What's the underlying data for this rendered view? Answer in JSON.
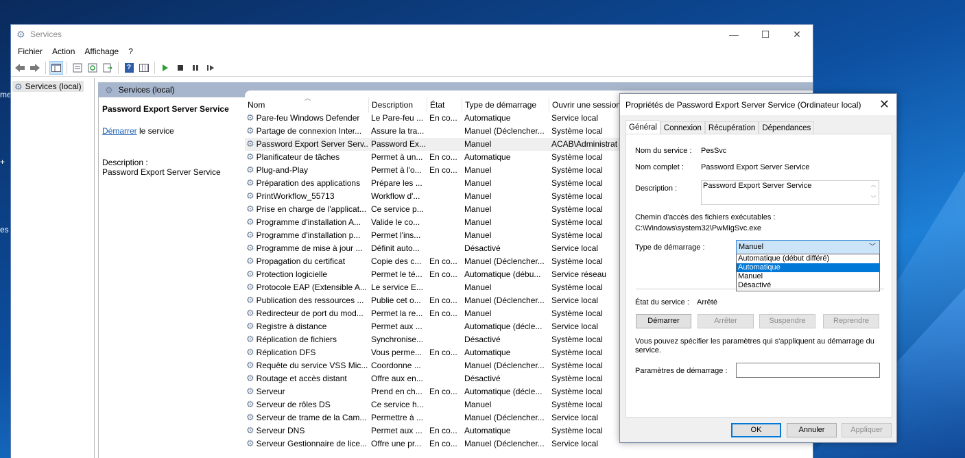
{
  "desktop": {
    "fragments": [
      "me",
      "+",
      "es"
    ]
  },
  "window": {
    "title": "Services",
    "controls": {
      "minimize": "—",
      "maximize": "☐",
      "close": "✕"
    }
  },
  "menu": [
    "Fichier",
    "Action",
    "Affichage",
    "?"
  ],
  "tree": {
    "root": "Services (local)"
  },
  "panel": {
    "header": "Services (local)"
  },
  "extended": {
    "service_name": "Password Export Server Service",
    "start_link": "Démarrer",
    "start_suffix": " le service",
    "description_label": "Description :",
    "description": "Password Export Server Service"
  },
  "columns": [
    "Nom",
    "Description",
    "État",
    "Type de démarrage",
    "Ouvrir une session"
  ],
  "rows": [
    {
      "name": "Pare-feu Windows Defender",
      "desc": "Le Pare-feu ...",
      "state": "En co...",
      "type": "Automatique",
      "logon": "Service local"
    },
    {
      "name": "Partage de connexion Inter...",
      "desc": "Assure la tra...",
      "state": "",
      "type": "Manuel (Déclencher...",
      "logon": "Système local"
    },
    {
      "name": "Password Export Server Serv...",
      "desc": "Password Ex...",
      "state": "",
      "type": "Manuel",
      "logon": "ACAB\\Administrat"
    },
    {
      "name": "Planificateur de tâches",
      "desc": "Permet à un...",
      "state": "En co...",
      "type": "Automatique",
      "logon": "Système local"
    },
    {
      "name": "Plug-and-Play",
      "desc": "Permet à l'o...",
      "state": "En co...",
      "type": "Manuel",
      "logon": "Système local"
    },
    {
      "name": "Préparation des applications",
      "desc": "Prépare les ...",
      "state": "",
      "type": "Manuel",
      "logon": "Système local"
    },
    {
      "name": "PrintWorkflow_55713",
      "desc": "Workflow d'...",
      "state": "",
      "type": "Manuel",
      "logon": "Système local"
    },
    {
      "name": "Prise en charge de l'applicat...",
      "desc": "Ce service p...",
      "state": "",
      "type": "Manuel",
      "logon": "Système local"
    },
    {
      "name": "Programme d'installation A...",
      "desc": "Valide le co...",
      "state": "",
      "type": "Manuel",
      "logon": "Système local"
    },
    {
      "name": "Programme d'installation p...",
      "desc": "Permet l'ins...",
      "state": "",
      "type": "Manuel",
      "logon": "Système local"
    },
    {
      "name": "Programme de mise à jour ...",
      "desc": "Définit auto...",
      "state": "",
      "type": "Désactivé",
      "logon": "Service local"
    },
    {
      "name": "Propagation du certificat",
      "desc": "Copie des c...",
      "state": "En co...",
      "type": "Manuel (Déclencher...",
      "logon": "Système local"
    },
    {
      "name": "Protection logicielle",
      "desc": "Permet le té...",
      "state": "En co...",
      "type": "Automatique (débu...",
      "logon": "Service réseau"
    },
    {
      "name": "Protocole EAP (Extensible A...",
      "desc": "Le service E...",
      "state": "",
      "type": "Manuel",
      "logon": "Système local"
    },
    {
      "name": "Publication des ressources ...",
      "desc": "Publie cet o...",
      "state": "En co...",
      "type": "Manuel (Déclencher...",
      "logon": "Service local"
    },
    {
      "name": "Redirecteur de port du mod...",
      "desc": "Permet la re...",
      "state": "En co...",
      "type": "Manuel",
      "logon": "Système local"
    },
    {
      "name": "Registre à distance",
      "desc": "Permet aux ...",
      "state": "",
      "type": "Automatique (décle...",
      "logon": "Service local"
    },
    {
      "name": "Réplication de fichiers",
      "desc": "Synchronise...",
      "state": "",
      "type": "Désactivé",
      "logon": "Système local"
    },
    {
      "name": "Réplication DFS",
      "desc": "Vous perme...",
      "state": "En co...",
      "type": "Automatique",
      "logon": "Système local"
    },
    {
      "name": "Requête du service VSS Mic...",
      "desc": "Coordonne ...",
      "state": "",
      "type": "Manuel (Déclencher...",
      "logon": "Système local"
    },
    {
      "name": "Routage et accès distant",
      "desc": "Offre aux en...",
      "state": "",
      "type": "Désactivé",
      "logon": "Système local"
    },
    {
      "name": "Serveur",
      "desc": "Prend en ch...",
      "state": "En co...",
      "type": "Automatique (décle...",
      "logon": "Système local"
    },
    {
      "name": "Serveur de rôles DS",
      "desc": "Ce service h...",
      "state": "",
      "type": "Manuel",
      "logon": "Système local"
    },
    {
      "name": "Serveur de trame de la Cam...",
      "desc": "Permettre à ...",
      "state": "",
      "type": "Manuel (Déclencher...",
      "logon": "Service local"
    },
    {
      "name": "Serveur DNS",
      "desc": "Permet aux ...",
      "state": "En co...",
      "type": "Automatique",
      "logon": "Système local"
    },
    {
      "name": "Serveur Gestionnaire de lice...",
      "desc": "Offre une pr...",
      "state": "En co...",
      "type": "Manuel (Déclencher...",
      "logon": "Service local"
    }
  ],
  "dialog": {
    "title": "Propriétés de Password Export Server Service (Ordinateur local)",
    "close": "✕",
    "tabs": [
      "Général",
      "Connexion",
      "Récupération",
      "Dépendances"
    ],
    "service_name_label": "Nom du service :",
    "service_name": "PesSvc",
    "full_name_label": "Nom complet :",
    "full_name": "Password Export Server Service",
    "description_label": "Description :",
    "description": "Password Export Server Service",
    "path_label": "Chemin d'accès des fichiers exécutables :",
    "path": "C:\\Windows\\system32\\PwMigSvc.exe",
    "startup_label": "Type de démarrage :",
    "startup_value": "Manuel",
    "startup_options": [
      "Automatique (début différé)",
      "Automatique",
      "Manuel",
      "Désactivé"
    ],
    "status_label": "État du service :",
    "status_value": "Arrêté",
    "buttons": {
      "start": "Démarrer",
      "stop": "Arrêter",
      "pause": "Suspendre",
      "resume": "Reprendre"
    },
    "hint": "Vous pouvez spécifier les paramètres qui s'appliquent au démarrage du service.",
    "params_label": "Paramètres de démarrage :",
    "params_value": "",
    "footer": {
      "ok": "OK",
      "cancel": "Annuler",
      "apply": "Appliquer"
    }
  }
}
